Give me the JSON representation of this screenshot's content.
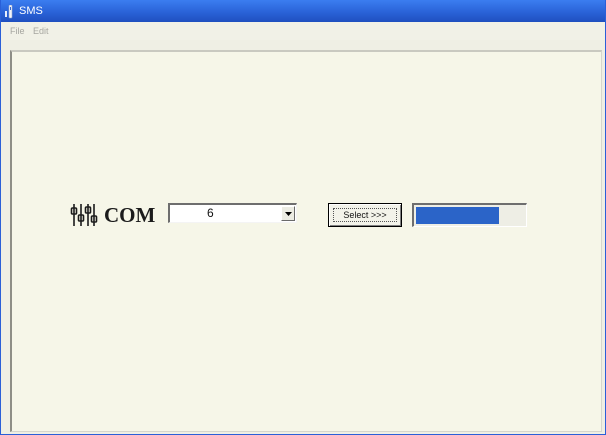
{
  "window": {
    "title": "SMS",
    "title_icon": "phone-icon"
  },
  "menu": {
    "items": [
      {
        "label": "File"
      },
      {
        "label": "Edit"
      }
    ]
  },
  "form": {
    "com_icon": "serial-port-icon",
    "com_label": "COM",
    "com_port_value": "6",
    "select_button_label": "Select >>>",
    "progress_fraction": 0.77
  },
  "colors": {
    "titlebar": "#2a63d8",
    "progress_fill": "#2b64c8",
    "client_background": "#f6f6e8"
  }
}
